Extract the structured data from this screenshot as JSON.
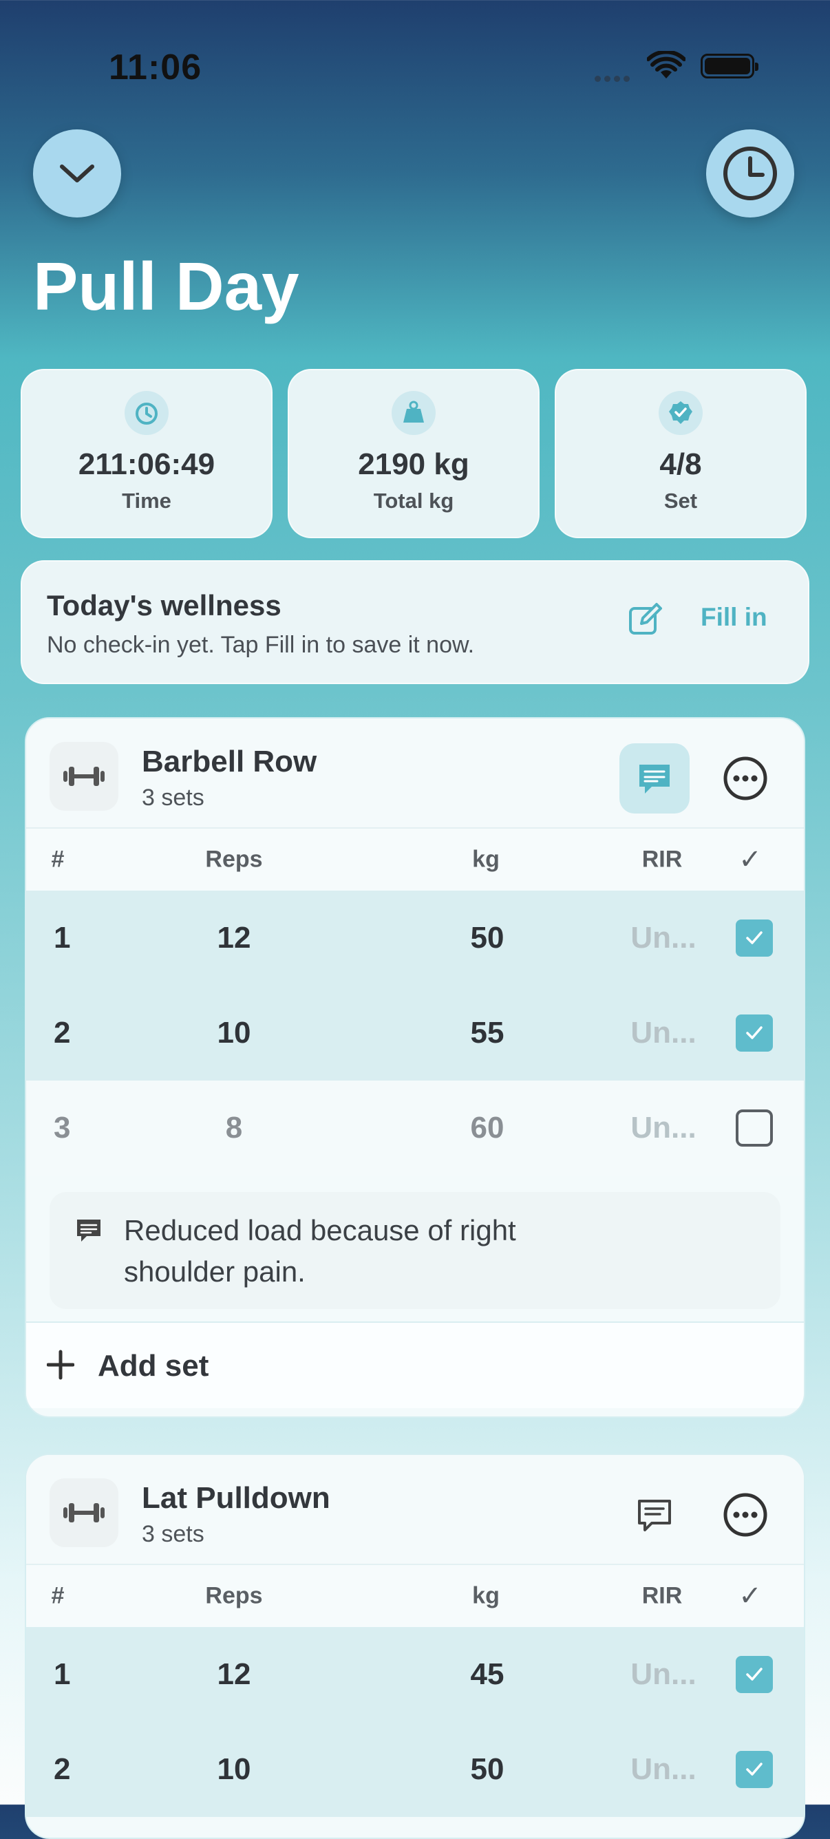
{
  "status": {
    "time": "11:06"
  },
  "header": {
    "title": "Pull Day"
  },
  "stats": [
    {
      "value": "211:06:49",
      "label": "Time",
      "icon": "timer-icon"
    },
    {
      "value": "2190 kg",
      "label": "Total kg",
      "icon": "weight-icon"
    },
    {
      "value": "4/8",
      "label": "Set",
      "icon": "badge-check-icon"
    }
  ],
  "wellness": {
    "title": "Today's wellness",
    "subtitle": "No check-in yet. Tap Fill in to save it now.",
    "action": "Fill in"
  },
  "columns": {
    "num": "#",
    "reps": "Reps",
    "kg": "kg",
    "rir": "RIR",
    "check": "✓"
  },
  "exercises": [
    {
      "name": "Barbell Row",
      "sets_label": "3 sets",
      "sets": [
        {
          "num": "1",
          "reps": "12",
          "kg": "50",
          "rir": "Un...",
          "done": true
        },
        {
          "num": "2",
          "reps": "10",
          "kg": "55",
          "rir": "Un...",
          "done": true
        },
        {
          "num": "3",
          "reps": "8",
          "kg": "60",
          "rir": "Un...",
          "done": false
        }
      ],
      "note": "Reduced load because of right shoulder pain.",
      "add_set": "Add set"
    },
    {
      "name": "Lat Pulldown",
      "sets_label": "3 sets",
      "sets": [
        {
          "num": "1",
          "reps": "12",
          "kg": "45",
          "rir": "Un...",
          "done": true
        },
        {
          "num": "2",
          "reps": "10",
          "kg": "50",
          "rir": "Un...",
          "done": true
        }
      ]
    }
  ],
  "colors": {
    "accent": "#5fbccc",
    "title": "#ffffff"
  }
}
